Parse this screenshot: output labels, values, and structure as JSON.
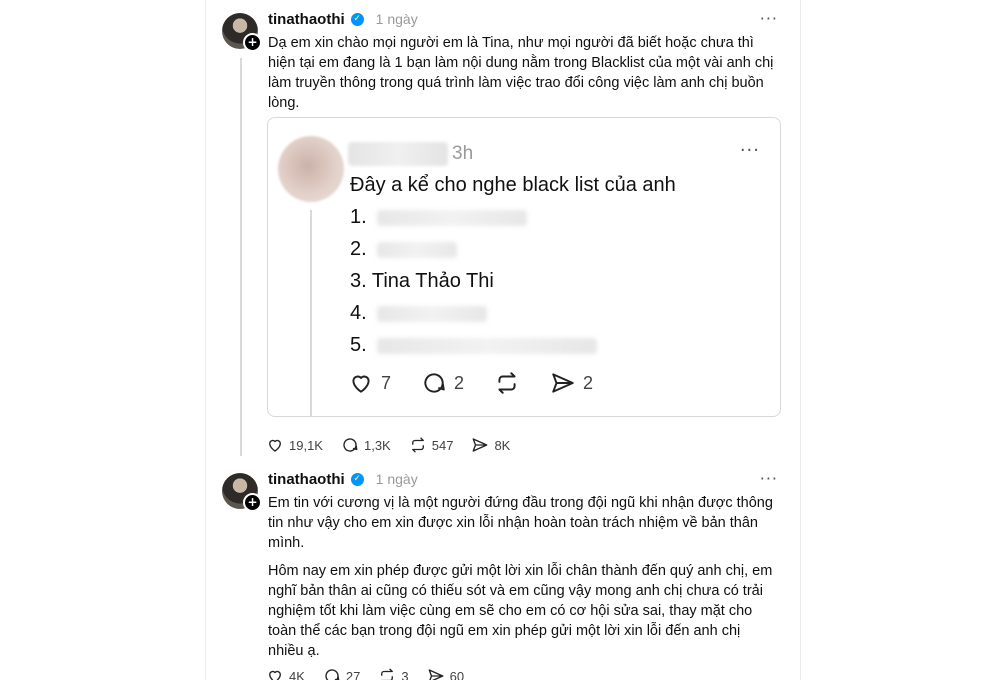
{
  "post1": {
    "username": "tinathaothi",
    "time": "1 ngày",
    "more": "···",
    "text": "Dạ em xin chào mọi người em là Tina, như mọi người đã biết hoặc chưa thì hiện tại em đang là 1 bạn làm nội dung nằm trong Blacklist của một vài anh chị làm truyền thông trong quá trình làm việc trao đổi công việc làm anh chị buồn lòng.",
    "quote": {
      "time": "3h",
      "more": "···",
      "text": "Đây a kể cho nghe black list của anh",
      "items": [
        "1.",
        "2.",
        "3. Tina Thảo Thi",
        "4.",
        "5."
      ],
      "likes": "7",
      "replies": "2",
      "shares": "2"
    },
    "likes": "19,1K",
    "replies": "1,3K",
    "reposts": "547",
    "shares": "8K"
  },
  "post2": {
    "username": "tinathaothi",
    "time": "1 ngày",
    "more": "···",
    "para1": "Em tin với cương vị là một người đứng đầu trong đội ngũ khi nhận được thông tin như vậy cho em xin được xin lỗi nhận hoàn toàn trách nhiệm về bản thân mình.",
    "para2": "Hôm nay em xin phép được gửi một lời xin lỗi chân thành đến quý anh chị, em nghĩ bản thân ai cũng có thiếu sót và em cũng vậy mong anh chị chưa có trải nghiệm tốt khi làm việc cùng em sẽ cho em có cơ hội sửa sai, thay mặt cho toàn thể các bạn trong đội ngũ em xin phép gửi một lời xin lỗi đến anh chị nhiều ạ.",
    "likes": "4K",
    "replies": "27",
    "reposts": "3",
    "shares": "60"
  },
  "icons": {
    "verified": "verified-badge-icon",
    "like": "heart-icon",
    "reply": "comment-icon",
    "repost": "repost-icon",
    "share": "send-icon",
    "plus": "+"
  },
  "colors": {
    "verified": "#0095f6",
    "muted": "#999999",
    "text": "#101010"
  }
}
